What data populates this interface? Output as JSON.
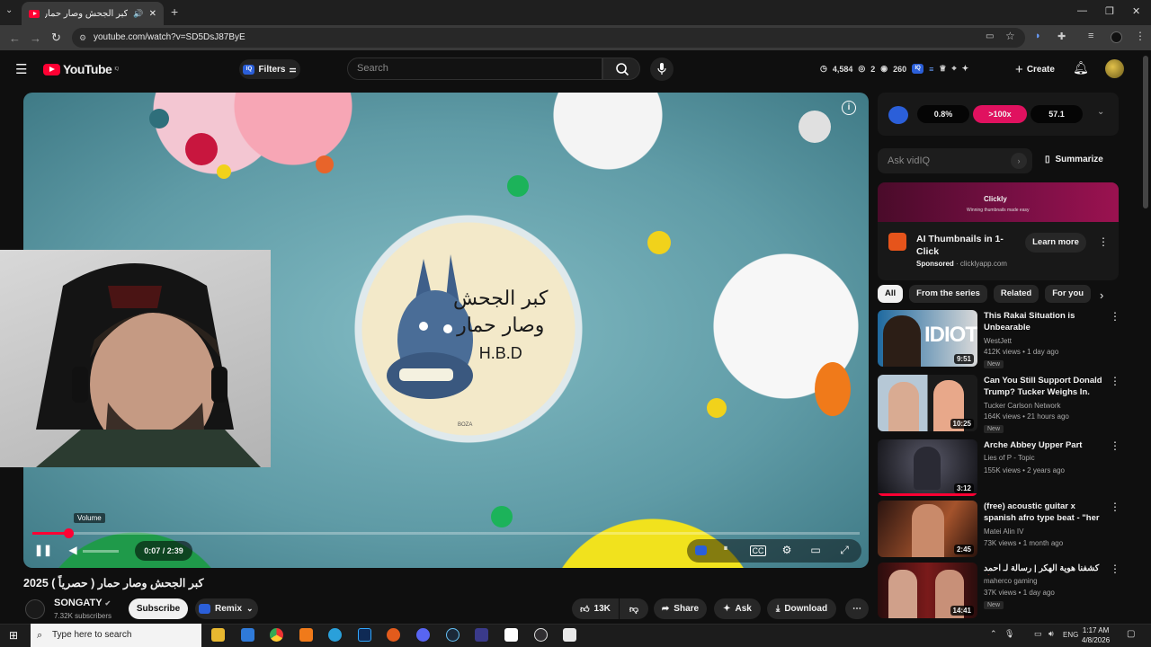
{
  "browser": {
    "tab_title": "كبر الجحش وصار حمار ( حصرياً )",
    "url": "youtube.com/watch?v=SD5DsJ87ByE"
  },
  "header": {
    "logo_text": "YouTube",
    "logo_sup": "IQ",
    "filters_label": "Filters",
    "search_placeholder": "Search",
    "stats": {
      "views": "4,584",
      "a": "2",
      "b": "260"
    },
    "create_label": "Create"
  },
  "player": {
    "time": "0:07 / 2:39",
    "progress_fraction": 0.044,
    "volume_tooltip": "Volume",
    "watermark": "BOZA"
  },
  "video": {
    "title": "كبر الجحش وصار حمار ( حصرياً ) 2025",
    "channel": "SONGATY",
    "subscribers": "7.32K subscribers",
    "subscribe_label": "Subscribe",
    "remix_label": "Remix",
    "likes": "13K",
    "share_label": "Share",
    "ask_label": "Ask",
    "download_label": "Download"
  },
  "vidiq": {
    "m1": "0.8%",
    "m2": ">100x",
    "m3": "57.1",
    "ask_placeholder": "Ask vidIQ",
    "summarize_label": "Summarize"
  },
  "ad": {
    "brand": "Clickly",
    "tagline": "Winning thumbnails made easy",
    "title": "AI Thumbnails in 1-Click",
    "sponsored": "Sponsored",
    "domain": "clicklyapp.com",
    "cta": "Learn more"
  },
  "chips": [
    "All",
    "From the series",
    "Related",
    "For you"
  ],
  "recs": [
    {
      "title": "This Rakai Situation is Unbearable",
      "channel": "WestJett",
      "meta": "412K views • 1 day ago",
      "new": "New",
      "duration": "9:51",
      "thumb_text": "IDIOT"
    },
    {
      "title": "Can You Still Support Donald Trump? Tucker Weighs In.",
      "channel": "Tucker Carlson Network",
      "meta": "164K views • 21 hours ago",
      "new": "New",
      "duration": "10:25",
      "thumb_text": ""
    },
    {
      "title": "Arche Abbey Upper Part",
      "channel": "Lies of P - Topic",
      "meta": "155K views • 2 years ago",
      "new": "",
      "duration": "3:12",
      "thumb_text": ""
    },
    {
      "title": "(free) acoustic guitar x spanish afro type beat - \"her name\"",
      "channel": "Matei Alin IV",
      "meta": "73K views • 1 month ago",
      "new": "",
      "duration": "2:45",
      "thumb_text": ""
    },
    {
      "title": "كشفنا هوية الهكر | رسالة لـ احمد شو 🔥",
      "channel": "maherco gaming",
      "meta": "37K views • 1 day ago",
      "new": "New",
      "duration": "14:41",
      "thumb_text": ""
    }
  ],
  "taskbar": {
    "search_placeholder": "Type here to search",
    "lang": "ENG",
    "time": "1:17 AM",
    "date": "4/8/2026"
  },
  "colors": {
    "accent": "#ff0033",
    "vidiq_blue": "#2b5fd9",
    "vidiq_pink": "#e0115f"
  }
}
